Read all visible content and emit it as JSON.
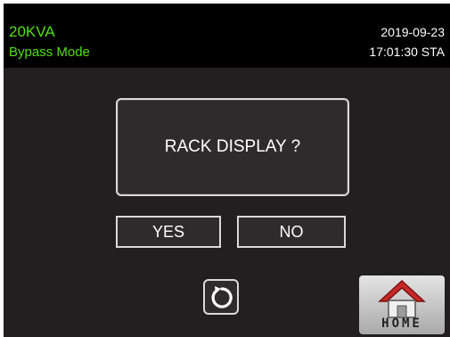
{
  "status": {
    "model": "20KVA",
    "mode": "Bypass Mode",
    "date": "2019-09-23",
    "time": "17:01:30 STA"
  },
  "dialog": {
    "message": "RACK DISPLAY ?"
  },
  "buttons": {
    "yes": "YES",
    "no": "NO",
    "home": "HOME"
  },
  "icons": {
    "back": "refresh-back-icon",
    "home": "house-icon"
  },
  "colors": {
    "status_text": "#4ee10a",
    "background": "#231f20",
    "home_roof": "#c62828"
  }
}
